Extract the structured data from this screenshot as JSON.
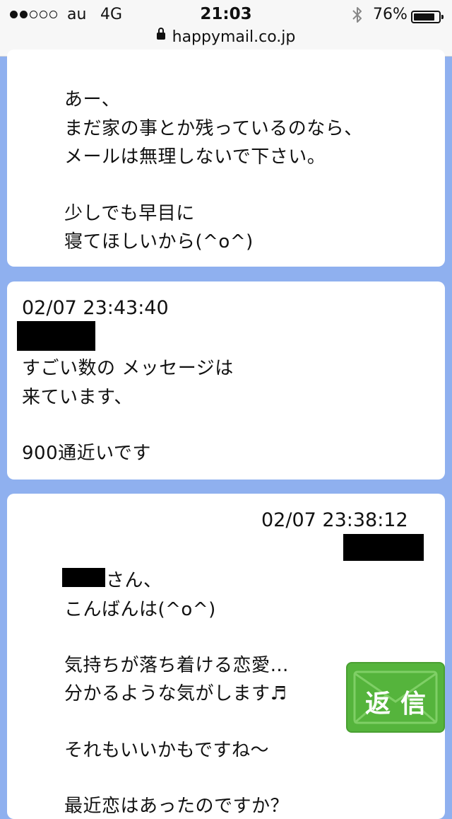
{
  "status_bar": {
    "carrier": "au",
    "network": "4G",
    "time": "21:03",
    "battery_percent": "76%",
    "battery_level": 0.76,
    "signal_bars_filled": 2,
    "signal_bars_total": 5,
    "url": "happymail.co.jp"
  },
  "messages": [
    {
      "lines": [
        "あー、",
        "まだ家の事とか残っているのなら、",
        "メールは無理しないで下さい。",
        "",
        "少しでも早目に",
        "寝てほしいから(^o^)"
      ]
    },
    {
      "timestamp": "02/07 23:43:40",
      "lines": [
        "すごい数の メッセージは",
        "来ています、",
        "",
        "900通近いです"
      ]
    },
    {
      "timestamp": "02/07 23:38:12",
      "name_suffix": "さん、",
      "lines": [
        "こんばんは(^o^)",
        "",
        "気持ちが落ち着ける恋愛…",
        "分かるような気がします♬",
        "",
        "それもいいかもですね～",
        "",
        "最近恋はあったのですか？"
      ]
    }
  ],
  "reply_button": {
    "label": "返信"
  },
  "colors": {
    "background": "#8fb0ef",
    "reply_green": "#55b43c"
  }
}
